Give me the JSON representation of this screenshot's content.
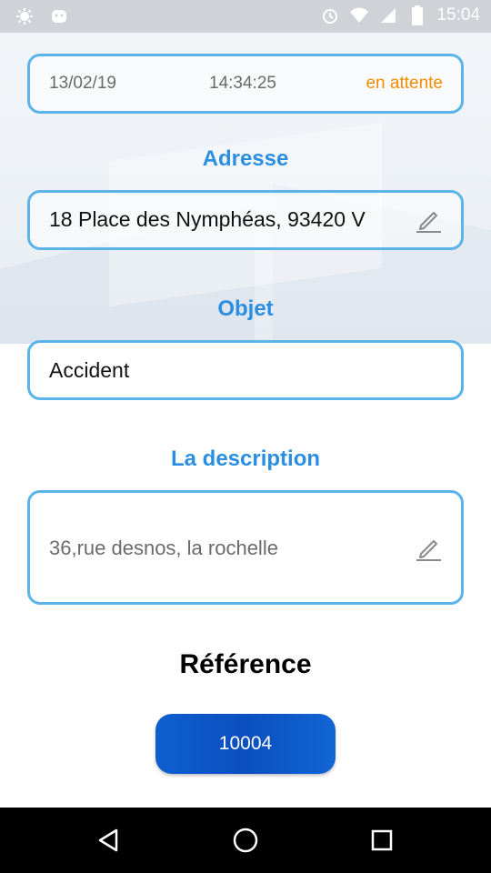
{
  "status_bar": {
    "time": "15:04",
    "icons": [
      "notification-icon",
      "android-icon",
      "alarm-icon",
      "wifi-icon",
      "signal-icon",
      "battery-icon"
    ]
  },
  "info": {
    "date": "13/02/19",
    "time": "14:34:25",
    "status": "en attente"
  },
  "address": {
    "label": "Adresse",
    "value": "18 Place des Nymphéas, 93420 V"
  },
  "object": {
    "label": "Objet",
    "value": "Accident"
  },
  "description": {
    "label": "La description",
    "value": "36,rue desnos, la rochelle"
  },
  "reference": {
    "label": "Référence",
    "value": "10004"
  },
  "colors": {
    "accent": "#2a8fe0",
    "border": "#5ab4ea",
    "status": "#f28c00",
    "button": "#0b4fc0"
  }
}
